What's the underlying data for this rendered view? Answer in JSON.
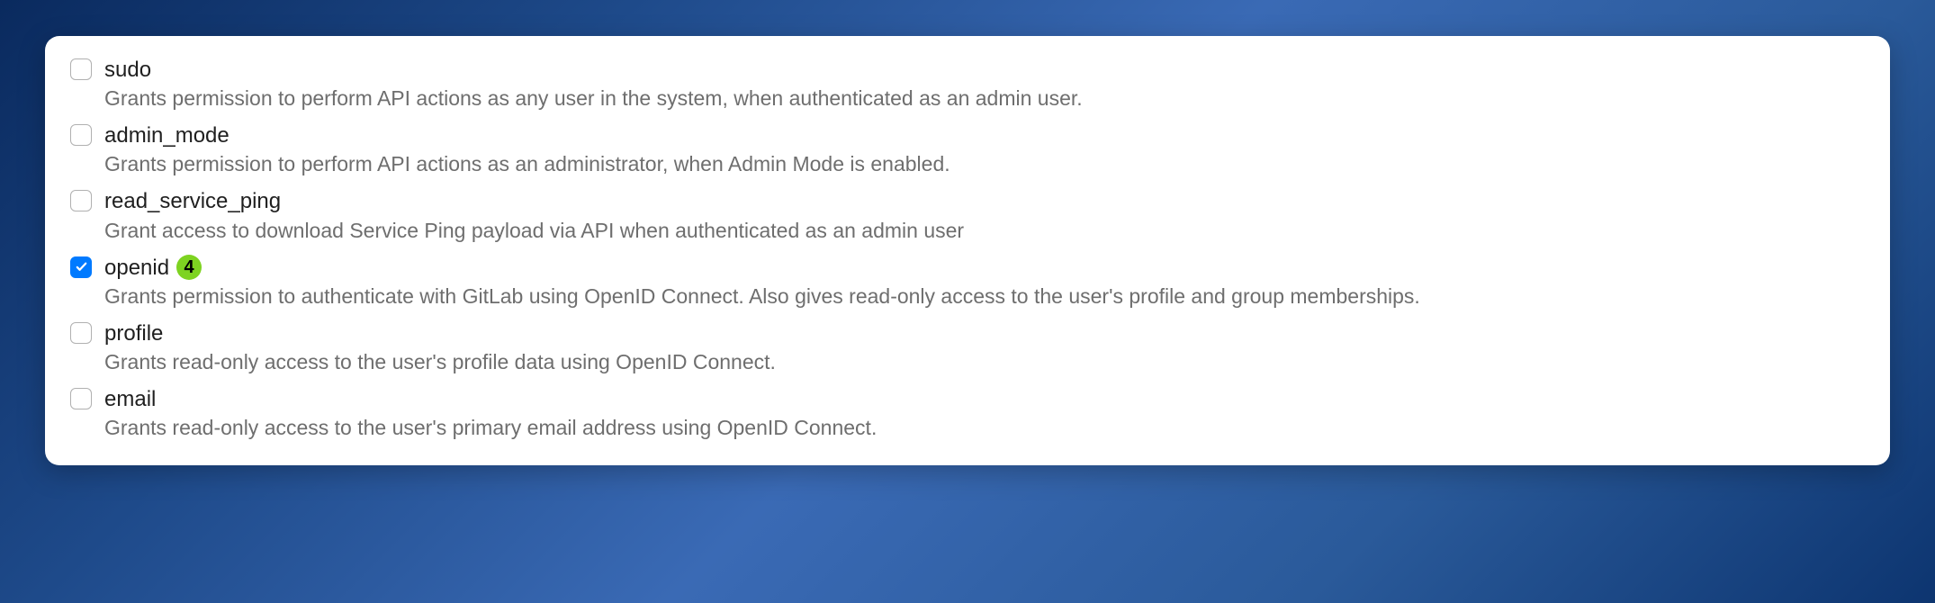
{
  "scopes": [
    {
      "id": "sudo",
      "label": "sudo",
      "description": "Grants permission to perform API actions as any user in the system, when authenticated as an admin user.",
      "checked": false,
      "badge": null
    },
    {
      "id": "admin_mode",
      "label": "admin_mode",
      "description": "Grants permission to perform API actions as an administrator, when Admin Mode is enabled.",
      "checked": false,
      "badge": null
    },
    {
      "id": "read_service_ping",
      "label": "read_service_ping",
      "description": "Grant access to download Service Ping payload via API when authenticated as an admin user",
      "checked": false,
      "badge": null
    },
    {
      "id": "openid",
      "label": "openid",
      "description": "Grants permission to authenticate with GitLab using OpenID Connect. Also gives read-only access to the user's profile and group memberships.",
      "checked": true,
      "badge": "4"
    },
    {
      "id": "profile",
      "label": "profile",
      "description": "Grants read-only access to the user's profile data using OpenID Connect.",
      "checked": false,
      "badge": null
    },
    {
      "id": "email",
      "label": "email",
      "description": "Grants read-only access to the user's primary email address using OpenID Connect.",
      "checked": false,
      "badge": null
    }
  ],
  "colors": {
    "checkbox_checked": "#007aff",
    "badge_bg": "#7ed321"
  }
}
